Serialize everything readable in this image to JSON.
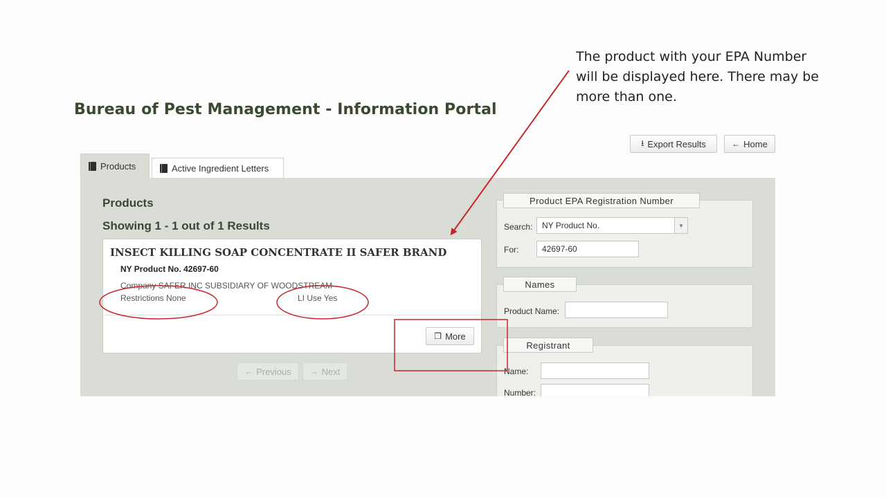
{
  "annotation": {
    "text": "The product with your EPA Number\nwill be displayed here.  There may be\nmore than one."
  },
  "portal": {
    "title": "Bureau of Pest Management - Information Portal"
  },
  "toolbar": {
    "export_label": "Export Results",
    "home_label": "Home"
  },
  "tabs": [
    {
      "label": "Products",
      "active": true
    },
    {
      "label": "Active Ingredient Letters",
      "active": false
    }
  ],
  "products": {
    "heading": "Products",
    "showing": "Showing 1 - 1 out of 1 Results",
    "result": {
      "name": "INSECT KILLING SOAP CONCENTRATE II SAFER BRAND",
      "ny_product_no": "NY Product No. 42697-60",
      "company": "Company SAFER INC SUBSIDIARY OF WOODSTREAM",
      "restrictions": "Restrictions None",
      "li_use": "LI Use Yes",
      "more_label": "More"
    },
    "pagination": {
      "previous_label": "Previous",
      "next_label": "Next"
    }
  },
  "search_panel": {
    "epa": {
      "legend": "Product EPA Registration Number",
      "search_label": "Search:",
      "search_value": "NY Product No.",
      "for_label": "For:",
      "for_value": "42697-60"
    },
    "names": {
      "legend": "Names",
      "product_name_label": "Product Name:",
      "product_name_value": ""
    },
    "registrant": {
      "legend": "Registrant",
      "name_label": "Name:",
      "number_label": "Number:"
    }
  },
  "colors": {
    "annotation_red": "#c8262c",
    "title_green": "#3b4a2f",
    "panel_bg": "#d9ddd6"
  }
}
